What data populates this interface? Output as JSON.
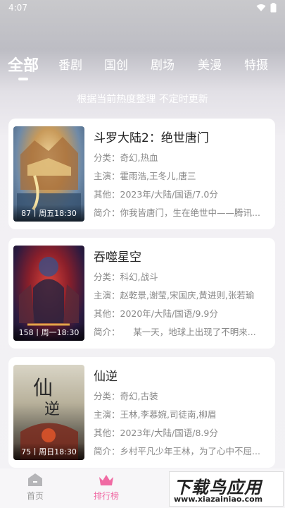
{
  "status": {
    "time": "4:07"
  },
  "tabs": [
    "全部",
    "番剧",
    "国创",
    "剧场",
    "美漫",
    "特摄"
  ],
  "subtitle": "根据当前热度整理 不定时更新",
  "items": [
    {
      "title": "斗罗大陆2：绝世唐门",
      "badge": "87丨周五18:30",
      "category": "分类：奇幻,热血",
      "cast": "主演：霍雨浩,王冬儿,唐三",
      "other": "其他：2023年/大陆/国语/7.0分",
      "intro": "简介：你我皆唐门，生在绝世中——腾讯..."
    },
    {
      "title": "吞噬星空",
      "badge": "158丨周一18:30",
      "category": "分类：科幻,战斗",
      "cast": "主演：赵乾景,谢莹,宋国庆,黄进则,张若瑜",
      "other": "其他：2020年/大陆/国语/9.9分",
      "intro": "简介：　　某一天，地球上出现了不明来..."
    },
    {
      "title": "仙逆",
      "badge": "75丨周日18:30",
      "category": "分类：奇幻,古装",
      "cast": "主演：王林,李慕婉,司徒南,柳眉",
      "other": "其他：2023年/大陆/国语/8.9分",
      "intro": "简介：乡村平凡少年王林，为了心中不屈..."
    }
  ],
  "nav": {
    "home": "首页",
    "rank": "排行榜",
    "third": ""
  },
  "watermark": {
    "big": "下载鸟应用",
    "small": "www.xiazainiao.com"
  },
  "colors": {
    "accent": "#f06aa3"
  }
}
